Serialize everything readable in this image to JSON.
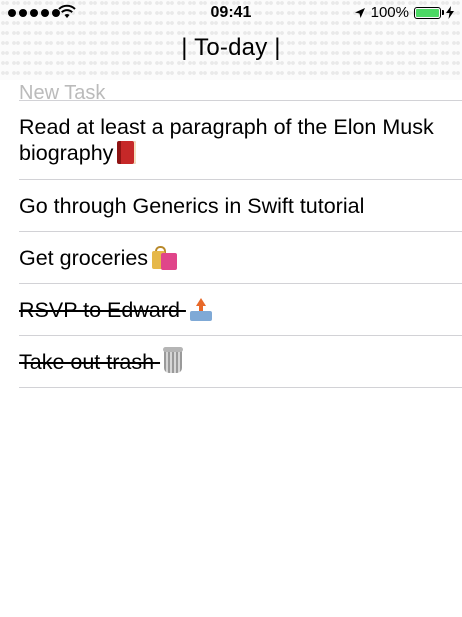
{
  "status_bar": {
    "time": "09:41",
    "battery_percent": "100%",
    "battery_level": 1.0,
    "signal_bars": 5,
    "icons": [
      "cellular-signal-icon",
      "wifi-icon",
      "location-arrow-icon",
      "battery-icon",
      "charging-bolt-icon"
    ]
  },
  "nav": {
    "title": "| To-day |"
  },
  "tasks": [
    {
      "label": "New Task",
      "completed": false,
      "emoji": ""
    },
    {
      "label": "Read at least a paragraph of the Elon Musk biography",
      "completed": false,
      "emoji": "book-icon"
    },
    {
      "label": "Go through Generics in Swift tutorial",
      "completed": false,
      "emoji": ""
    },
    {
      "label": "Get groceries",
      "completed": false,
      "emoji": "shopping-bags-icon"
    },
    {
      "label": "RSVP to Edward",
      "completed": true,
      "emoji": "outbox-tray-icon"
    },
    {
      "label": "Take out trash",
      "completed": true,
      "emoji": "wastebasket-icon"
    }
  ],
  "colors": {
    "battery_fill": "#4cd964",
    "separator": "#d2d2d6",
    "text": "#000000"
  }
}
